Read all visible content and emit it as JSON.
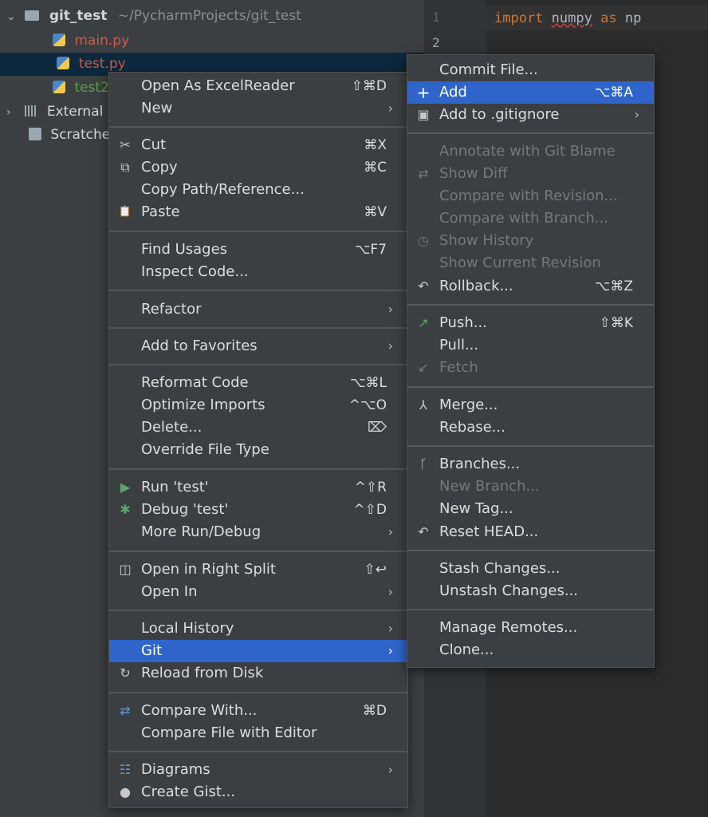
{
  "tree": {
    "root_name": "git_test",
    "root_path": "~/PycharmProjects/git_test",
    "files": [
      {
        "label": "main.py",
        "color": "#cc5a4b"
      },
      {
        "label": "test.py",
        "color": "#cc5a4b"
      },
      {
        "label": "test2",
        "color": "#5c9d47"
      }
    ],
    "external_label": "External",
    "scratches_label": "Scratche"
  },
  "editor": {
    "line_numbers": [
      "1",
      "2"
    ],
    "code_import": "import",
    "code_module": "numpy",
    "code_as": "as",
    "code_alias": "np"
  },
  "context_menu": {
    "items": [
      {
        "label": "Open As ExcelReader",
        "shortcut": "⇧⌘D"
      },
      {
        "label": "New",
        "arrow": "›"
      },
      {
        "label": "Cut",
        "shortcut": "⌘X",
        "icon": "✂"
      },
      {
        "label": "Copy",
        "shortcut": "⌘C",
        "icon": "⧉"
      },
      {
        "label": "Copy Path/Reference..."
      },
      {
        "label": "Paste",
        "shortcut": "⌘V",
        "icon": "📋"
      },
      {
        "label": "Find Usages",
        "shortcut": "⌥F7"
      },
      {
        "label": "Inspect Code..."
      },
      {
        "label": "Refactor",
        "arrow": "›"
      },
      {
        "label": "Add to Favorites",
        "arrow": "›"
      },
      {
        "label": "Reformat Code",
        "shortcut": "⌥⌘L"
      },
      {
        "label": "Optimize Imports",
        "shortcut": "^⌥O"
      },
      {
        "label": "Delete...",
        "shortcut": "⌦"
      },
      {
        "label": "Override File Type"
      },
      {
        "label": "Run 'test'",
        "shortcut": "^⇧R",
        "icon": "▶"
      },
      {
        "label": "Debug 'test'",
        "shortcut": "^⇧D",
        "icon": "✱"
      },
      {
        "label": "More Run/Debug",
        "arrow": "›"
      },
      {
        "label": "Open in Right Split",
        "shortcut": "⇧↩",
        "icon": "◫"
      },
      {
        "label": "Open In",
        "arrow": "›"
      },
      {
        "label": "Local History",
        "arrow": "›"
      },
      {
        "label": "Git",
        "arrow": "›"
      },
      {
        "label": "Reload from Disk",
        "icon": "↻"
      },
      {
        "label": "Compare With...",
        "shortcut": "⌘D",
        "icon": "⇄"
      },
      {
        "label": "Compare File with Editor"
      },
      {
        "label": "Diagrams",
        "arrow": "›",
        "icon": "☷"
      },
      {
        "label": "Create Gist...",
        "icon": "●"
      }
    ]
  },
  "git_menu": {
    "items": [
      {
        "label": "Commit File..."
      },
      {
        "label": "Add",
        "shortcut": "⌥⌘A",
        "icon": "+"
      },
      {
        "label": "Add to .gitignore",
        "arrow": "›",
        "icon": "▣"
      },
      {
        "label": "Annotate with Git Blame"
      },
      {
        "label": "Show Diff",
        "icon": "⇄"
      },
      {
        "label": "Compare with Revision..."
      },
      {
        "label": "Compare with Branch..."
      },
      {
        "label": "Show History",
        "icon": "◷"
      },
      {
        "label": "Show Current Revision"
      },
      {
        "label": "Rollback...",
        "shortcut": "⌥⌘Z",
        "icon": "↶"
      },
      {
        "label": "Push...",
        "shortcut": "⇧⌘K",
        "icon": "↗"
      },
      {
        "label": "Pull..."
      },
      {
        "label": "Fetch",
        "icon": "↙"
      },
      {
        "label": "Merge...",
        "icon": "⅄"
      },
      {
        "label": "Rebase..."
      },
      {
        "label": "Branches...",
        "icon": "ᚴ"
      },
      {
        "label": "New Branch..."
      },
      {
        "label": "New Tag..."
      },
      {
        "label": "Reset HEAD...",
        "icon": "↶"
      },
      {
        "label": "Stash Changes..."
      },
      {
        "label": "Unstash Changes..."
      },
      {
        "label": "Manage Remotes..."
      },
      {
        "label": "Clone..."
      }
    ]
  }
}
